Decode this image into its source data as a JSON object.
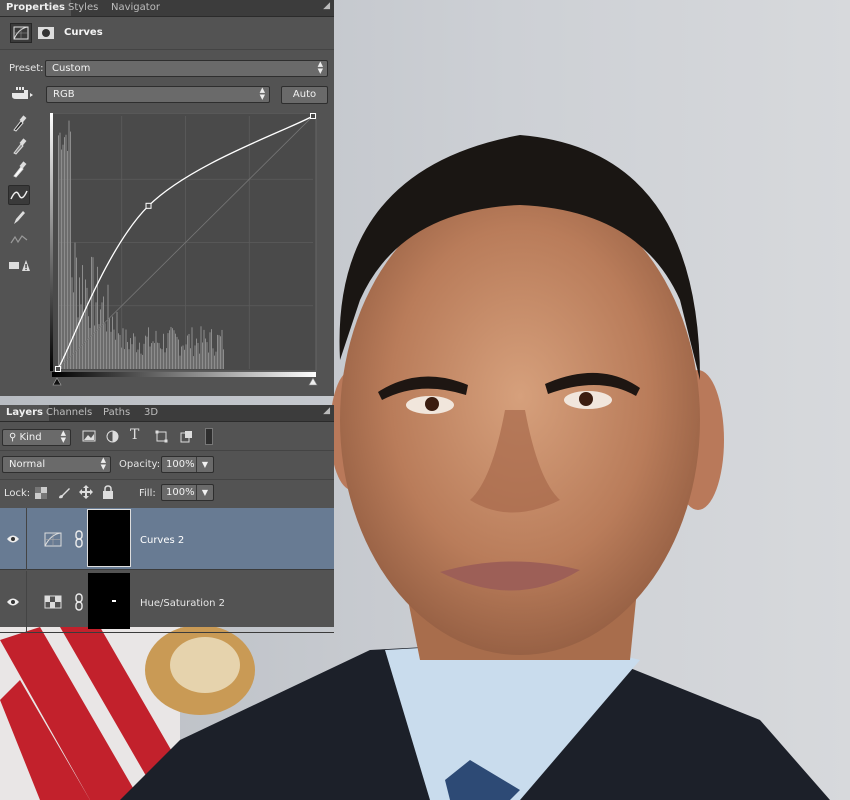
{
  "properties_panel": {
    "tabs": [
      "Properties",
      "Styles",
      "Navigator"
    ],
    "active_tab": "Properties",
    "adjustment_title": "Curves",
    "preset_label": "Preset:",
    "preset_value": "Custom",
    "channel_value": "RGB",
    "auto_label": "Auto",
    "curve_points_normalized": [
      [
        0,
        0
      ],
      [
        0.355,
        0.645
      ],
      [
        1,
        1
      ]
    ]
  },
  "layers_panel": {
    "tabs": [
      "Layers",
      "Channels",
      "Paths",
      "3D"
    ],
    "active_tab": "Layers",
    "filter_label": "Kind",
    "blend_mode": "Normal",
    "opacity_label": "Opacity:",
    "opacity_value": "100%",
    "lock_label": "Lock:",
    "fill_label": "Fill:",
    "fill_value": "100%",
    "layers": [
      {
        "name": "Curves 2",
        "selected": true
      },
      {
        "name": "Hue/Saturation 2",
        "selected": false
      }
    ]
  },
  "colors": {
    "panel_bg": "#535353",
    "tab_bar_bg": "#3c3c3c",
    "selected_layer": "#687b93",
    "graph_bg": "#4a4a4a"
  }
}
